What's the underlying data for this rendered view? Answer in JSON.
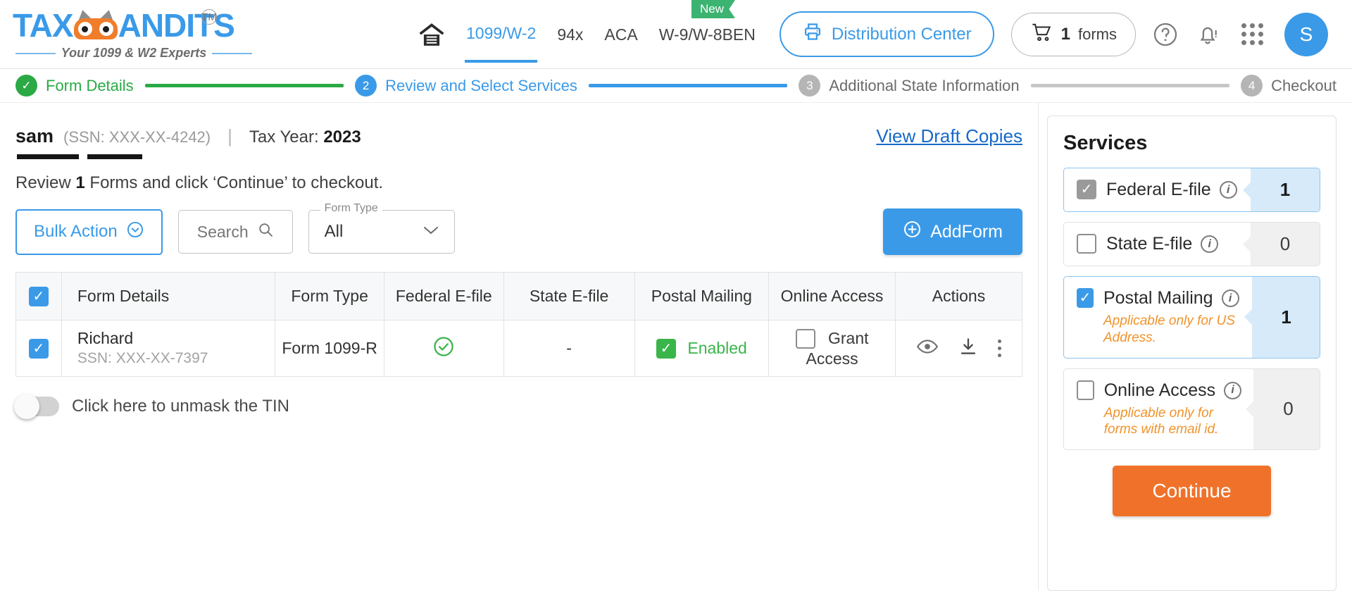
{
  "brand": {
    "name_part1": "TAX",
    "name_part2": "ANDITS",
    "trademark": "TM",
    "tagline": "Your 1099 & W2 Experts"
  },
  "topnav": {
    "home_icon": "home-icon",
    "items": [
      {
        "label": "1099/W-2",
        "active": true,
        "badge": ""
      },
      {
        "label": "94x",
        "active": false,
        "badge": ""
      },
      {
        "label": "ACA",
        "active": false,
        "badge": ""
      },
      {
        "label": "W-9/W-8BEN",
        "active": false,
        "badge": "New"
      }
    ],
    "distribution_center": "Distribution Center",
    "cart_count": "1",
    "cart_label": "forms",
    "help_icon": "question-mark-icon",
    "notification_icon": "bell-icon",
    "apps_icon": "grid-apps-icon",
    "avatar_initial": "S"
  },
  "stepper": {
    "steps": [
      {
        "num": "✓",
        "label": "Form Details",
        "state": "done"
      },
      {
        "num": "2",
        "label": "Review and Select Services",
        "state": "current"
      },
      {
        "num": "3",
        "label": "Additional State Information",
        "state": "todo"
      },
      {
        "num": "4",
        "label": "Checkout",
        "state": "todo"
      }
    ]
  },
  "header": {
    "person_name": "sam",
    "person_ssn": "(SSN: XXX-XX-4242)",
    "separator": "|",
    "tax_year_label": "Tax Year:",
    "tax_year_value": "2023",
    "draft_link": "View Draft Copies"
  },
  "review": {
    "prefix": "Review",
    "count": "1",
    "suffix": "Forms and click ‘Continue’ to checkout."
  },
  "controls": {
    "bulk_action": "Bulk Action",
    "search_label": "Search",
    "search_placeholder": "Search",
    "form_type_legend": "Form Type",
    "form_type_value": "All",
    "form_type_options": [
      "All"
    ],
    "add_form": "AddForm"
  },
  "table": {
    "columns": [
      "Form Details",
      "Form Type",
      "Federal E-file",
      "State E-file",
      "Postal Mailing",
      "Online Access",
      "Actions"
    ],
    "header_checkbox_checked": true,
    "rows": [
      {
        "checked": true,
        "name": "Richard",
        "ssn": "SSN: XXX-XX-7397",
        "form_type": "Form 1099-R",
        "federal_efile": "check-circle-icon",
        "state_efile": "-",
        "postal_mailing_checked": true,
        "postal_mailing_label": "Enabled",
        "online_access_checked": false,
        "online_access_label": "Grant Access",
        "actions": [
          "eye-icon",
          "download-icon",
          "kebab-menu-icon"
        ]
      }
    ]
  },
  "mask_toggle": {
    "enabled": false,
    "label": "Click here to unmask the TIN"
  },
  "services": {
    "title": "Services",
    "items": [
      {
        "name": "Federal E-file",
        "checked": true,
        "locked": true,
        "note": "",
        "count": "1",
        "highlight": true
      },
      {
        "name": "State E-file",
        "checked": false,
        "locked": false,
        "note": "",
        "count": "0",
        "highlight": false
      },
      {
        "name": "Postal Mailing",
        "checked": true,
        "locked": false,
        "note": "Applicable only for US Address.",
        "count": "1",
        "highlight": true
      },
      {
        "name": "Online Access",
        "checked": false,
        "locked": false,
        "note": "Applicable only for forms with email id.",
        "count": "0",
        "highlight": false
      }
    ],
    "continue_label": "Continue"
  },
  "colors": {
    "brand_blue": "#3a9ae8",
    "link_blue": "#1769c9",
    "success_green": "#2aa945",
    "check_green": "#3ab54a",
    "accent_orange": "#f0722a",
    "note_orange": "#f0932b",
    "badge_green": "#3cb371"
  }
}
